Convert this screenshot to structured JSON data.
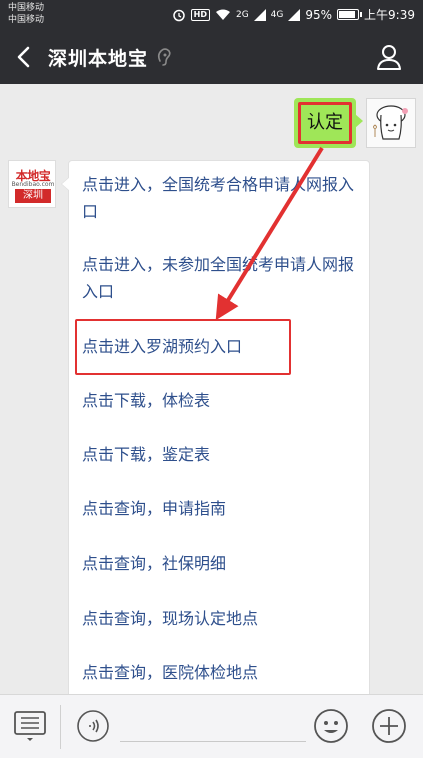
{
  "status_bar": {
    "carrier_1": "中国移动",
    "carrier_2": "中国移动",
    "hd": "HD",
    "sig1": "2G",
    "sig2": "4G",
    "battery": "95%",
    "time": "上午9:39",
    "battery_level": 0.95
  },
  "header": {
    "title": "深圳本地宝"
  },
  "chat": {
    "my_message": "认定",
    "bot_logo_top": "本地宝",
    "bot_logo_url": "Bendibao.com",
    "bot_logo_city": "深圳",
    "links": [
      "点击进入，全国统考合格申请人网报入口",
      "点击进入，未参加全国统考申请人网报入口",
      "点击进入罗湖预约入口",
      "点击下载，体检表",
      "点击下载，鉴定表",
      "点击查询，申请指南",
      "点击查询，社保明细",
      "点击查询，现场认定地点",
      "点击查询，医院体检地点"
    ]
  },
  "colors": {
    "header_bg": "#2d2e32",
    "my_bubble": "#9fe658",
    "link": "#2e4f8c",
    "annotation": "#e23131"
  }
}
